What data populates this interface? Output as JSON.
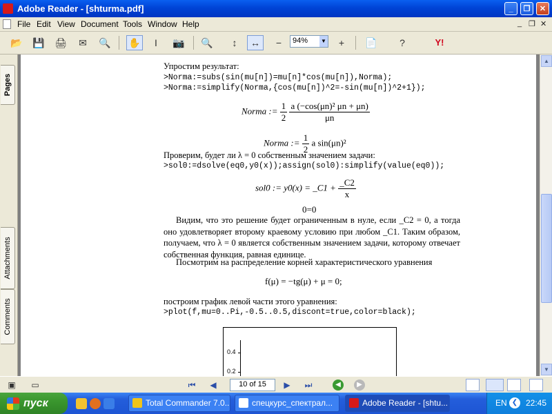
{
  "window": {
    "title": "Adobe Reader - [shturma.pdf]",
    "minimize": "_",
    "restore": "❐",
    "close": "✕"
  },
  "menu": {
    "items": [
      "File",
      "Edit",
      "View",
      "Document",
      "Tools",
      "Window",
      "Help"
    ],
    "mdi": [
      "_",
      "❐",
      "✕"
    ]
  },
  "toolbar": {
    "zoom_value": "94%",
    "icons": {
      "open": "📂",
      "save": "💾",
      "print": "🖨",
      "email": "✉",
      "search": "🔍",
      "hand": "✋",
      "select": "I",
      "snapshot": "📷",
      "zoom_in": "🔍",
      "fit_page": "↕",
      "fit_width": "↔",
      "zoom_out": "−",
      "zoom_in_circle": "+",
      "pages": "📄",
      "help": "?"
    },
    "yahoo": "Y!"
  },
  "nav_panel": {
    "tabs": [
      "Pages",
      "Attachments",
      "Comments"
    ]
  },
  "page": {
    "intro": "Упростим результат:",
    "code1": ">Norma:=subs(sin(mu[n])=mu[n]*cos(mu[n]),Norma);",
    "code2": ">Norma:=simplify(Norma,{cos(mu[n])^2=-sin(mu[n])^2+1});",
    "eq1": {
      "lhs": "Norma := ",
      "coef_num": "1",
      "coef_den": "2",
      "num": "a (−cos(μn)² μn + μn)",
      "den": "μn"
    },
    "eq2": {
      "lhs": "Norma := ",
      "coef_num": "1",
      "coef_den": "2",
      "rhs": "a sin(μn)²"
    },
    "check": "Проверим, будет ли λ = 0 собственным значением задачи:",
    "code3": ">sol0:=dsolve(eq0,y0(x));assign(sol0):simplify(value(eq0));",
    "eq3": {
      "lhs": "sol0 := y0(x) = _C1 + ",
      "num": "_C2",
      "den": "x"
    },
    "eq4": "0=0",
    "para1": "Видим, что это решение будет ограниченным в нуле, если _C2 = 0, а тогда оно удовлетворяет второму краевому условию при любом _C1. Таким образом, получаем, что λ = 0 является собственным значением задачи, которому отвечает собственная функция, равная единице.",
    "para2": "Посмотрим на распределение корней характеристического уравнения",
    "eq5": "f(μ) = −tg(μ) + μ = 0;",
    "plot_intro": "построим график левой части этого уравнения:",
    "code4": ">plot(f,mu=0..Pi,-0.5..0.5,discont=true,color=black);",
    "plot_labels": [
      "0.4",
      "0.2"
    ]
  },
  "scrollbar": {
    "up": "▲",
    "down": "▼"
  },
  "status": {
    "page_field": "10 of 15",
    "first": "⏮",
    "prev": "◀",
    "next": "▶",
    "last": "⏭",
    "back": "◀",
    "forward": "▶"
  },
  "taskbar": {
    "start": "пуск",
    "tasks": [
      "Total Commander 7.0...",
      "спецкурс_спектрал...",
      "Adobe Reader - [shtu..."
    ],
    "lang": "EN",
    "time": "22:45"
  }
}
